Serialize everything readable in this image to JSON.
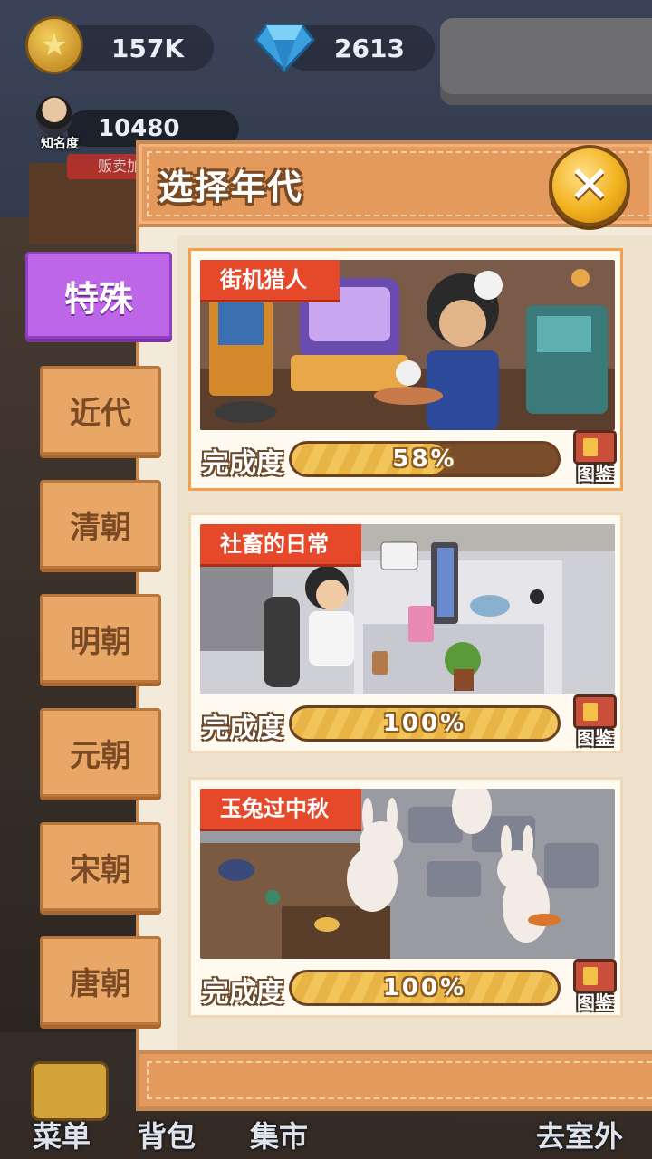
{
  "currency": {
    "coins": "157K",
    "gems": "2613"
  },
  "fame": {
    "label": "知名度",
    "value": "10480",
    "bonus_label": "贩卖加成"
  },
  "modal": {
    "title": "选择年代",
    "close_icon": "close-icon"
  },
  "eras": [
    {
      "label": "特殊",
      "active": true
    },
    {
      "label": "近代",
      "active": false
    },
    {
      "label": "清朝",
      "active": false
    },
    {
      "label": "明朝",
      "active": false
    },
    {
      "label": "元朝",
      "active": false
    },
    {
      "label": "宋朝",
      "active": false
    },
    {
      "label": "唐朝",
      "active": false
    }
  ],
  "cards": [
    {
      "title": "街机猎人",
      "progress_label": "完成度",
      "progress_text": "58%",
      "progress": 0.58,
      "gallery_label": "图鉴",
      "selected": true
    },
    {
      "title": "社畜的日常",
      "progress_label": "完成度",
      "progress_text": "100%",
      "progress": 1.0,
      "gallery_label": "图鉴",
      "selected": false
    },
    {
      "title": "玉兔过中秋",
      "progress_label": "完成度",
      "progress_text": "100%",
      "progress": 1.0,
      "gallery_label": "图鉴",
      "selected": false
    }
  ],
  "bottom_nav": {
    "menu": "菜单",
    "backpack": "背包",
    "market": "集市",
    "go_outdoors": "去室外"
  },
  "colors": {
    "active_tab": "#bd66e8",
    "tab": "#e8a667",
    "tag_red": "#e5492a",
    "progress_yellow": "#f2c55a"
  }
}
